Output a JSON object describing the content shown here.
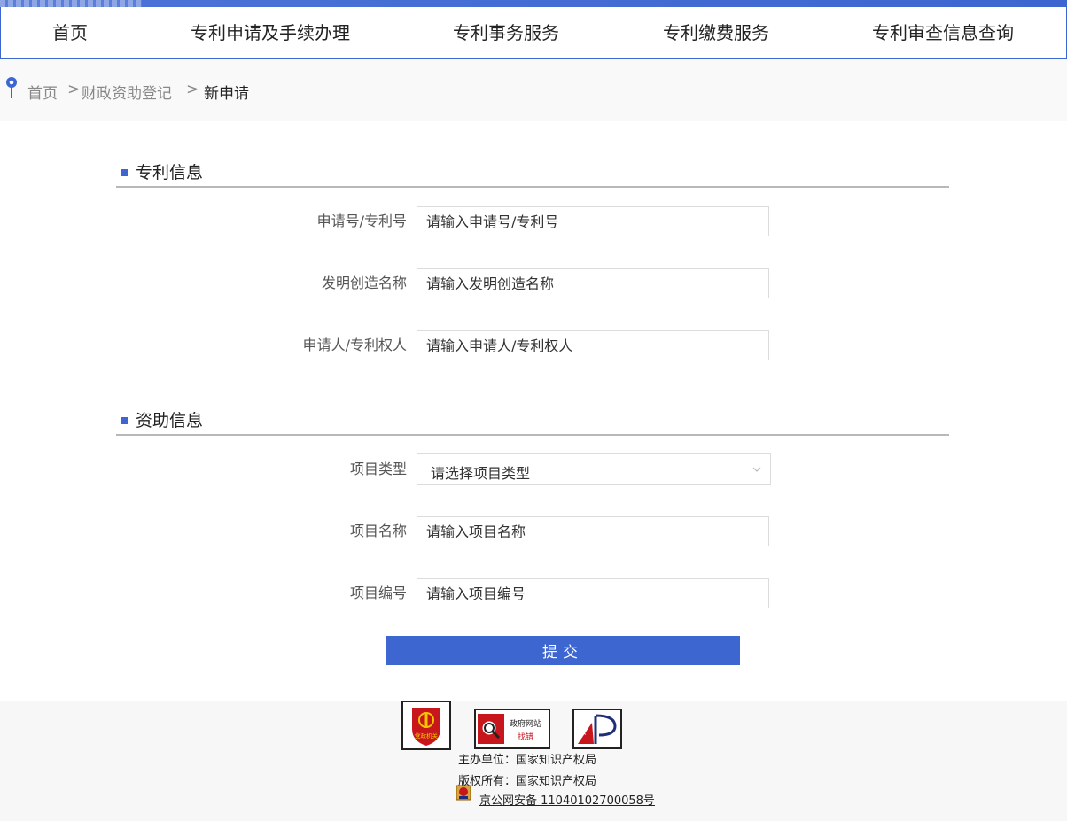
{
  "nav": {
    "items": [
      {
        "label": "首页"
      },
      {
        "label": "专利申请及手续办理"
      },
      {
        "label": "专利事务服务"
      },
      {
        "label": "专利缴费服务"
      },
      {
        "label": "专利审查信息查询"
      }
    ]
  },
  "breadcrumb": {
    "home": "首页",
    "sep1": ">",
    "level2": "财政资助登记",
    "sep2": ">",
    "current": "新申请"
  },
  "sections": {
    "patent": {
      "title": "专利信息"
    },
    "funding": {
      "title": "资助信息"
    }
  },
  "fields": {
    "app_number": {
      "label": "申请号/专利号",
      "placeholder": "请输入申请号/专利号"
    },
    "invention_name": {
      "label": "发明创造名称",
      "placeholder": "请输入发明创造名称"
    },
    "applicant": {
      "label": "申请人/专利权人",
      "placeholder": "请输入申请人/专利权人"
    },
    "project_type": {
      "label": "项目类型",
      "value": "请选择项目类型"
    },
    "project_name": {
      "label": "项目名称",
      "placeholder": "请输入项目名称"
    },
    "project_number": {
      "label": "项目编号",
      "placeholder": "请输入项目编号"
    }
  },
  "submit_label": "提交",
  "footer": {
    "badge1_text": "党政机关",
    "badge2_line1": "政府网站",
    "badge2_line2": "找错",
    "sponsor": "主办单位：国家知识产权局",
    "copyright": "版权所有：国家知识产权局",
    "icp": "京公网安备 11040102700058号"
  },
  "colors": {
    "accent": "#3d66d0",
    "badge_red": "#c8161d"
  }
}
